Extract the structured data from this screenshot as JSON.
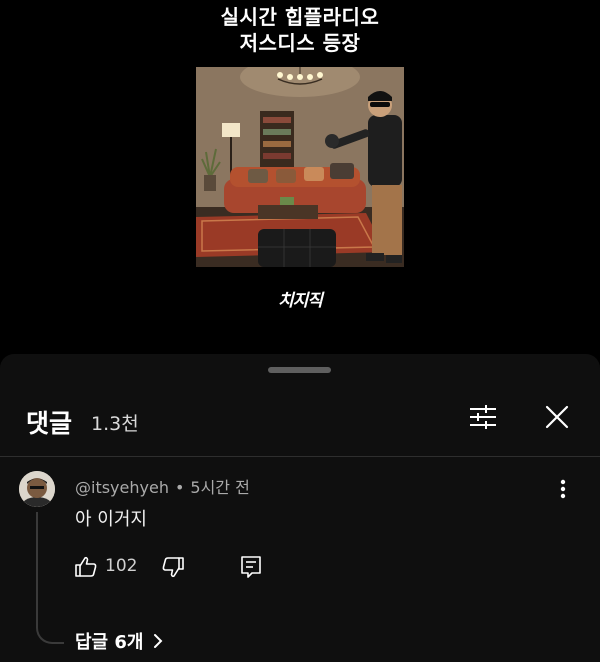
{
  "video": {
    "title_line1": "실시간 힙플라디오",
    "title_line2": "저스디스 등장",
    "logo_text": "치지직"
  },
  "comments_panel": {
    "title": "댓글",
    "count": "1.3천",
    "filter_icon": "sliders-icon",
    "close_icon": "close-icon"
  },
  "comment": {
    "author": "@itsyehyeh",
    "time": "5시간 전",
    "text": "아 이거지",
    "likes": "102",
    "replies_label": "답글 6개",
    "icons": [
      "thumbs-up-icon",
      "thumbs-down-icon",
      "reply-icon",
      "more-vertical-icon",
      "chevron-right-icon"
    ]
  }
}
